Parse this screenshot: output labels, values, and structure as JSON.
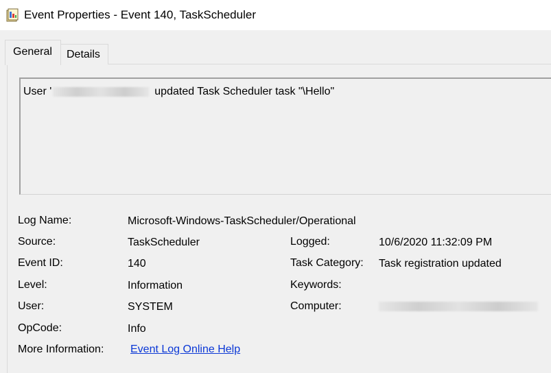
{
  "window": {
    "title": "Event Properties - Event 140, TaskScheduler",
    "icon": "event-viewer-icon"
  },
  "tabs": [
    {
      "label": "General",
      "selected": true
    },
    {
      "label": "Details",
      "selected": false
    }
  ],
  "message": {
    "prefix": "User '",
    "suffix": "updated Task Scheduler task \"\\Hello\""
  },
  "fields": {
    "log_name": {
      "label": "Log Name:",
      "value": "Microsoft-Windows-TaskScheduler/Operational"
    },
    "source": {
      "label": "Source:",
      "value": "TaskScheduler"
    },
    "logged": {
      "label": "Logged:",
      "value": "10/6/2020 11:32:09 PM"
    },
    "event_id": {
      "label": "Event ID:",
      "value": "140"
    },
    "task_category": {
      "label": "Task Category:",
      "value": "Task registration updated"
    },
    "level": {
      "label": "Level:",
      "value": "Information"
    },
    "keywords": {
      "label": "Keywords:",
      "value": ""
    },
    "user": {
      "label": "User:",
      "value": "SYSTEM"
    },
    "computer": {
      "label": "Computer:",
      "value": ""
    },
    "opcode": {
      "label": "OpCode:",
      "value": "Info"
    },
    "more_information": {
      "label": "More Information:",
      "value": "Event Log Online Help"
    }
  },
  "colors": {
    "background": "#f0f0f0",
    "titlebar": "#ffffff",
    "link": "#0a37d6"
  }
}
